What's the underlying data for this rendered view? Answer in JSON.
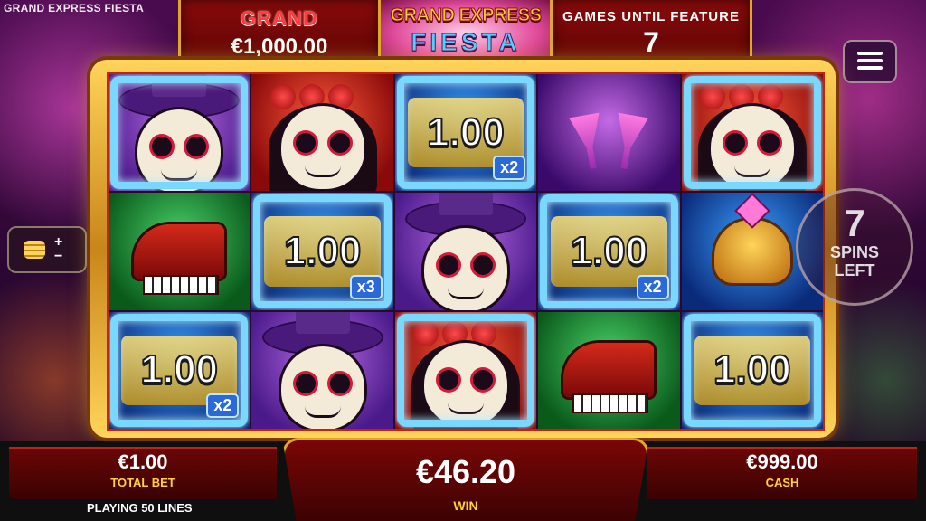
{
  "game": {
    "title": "GRAND EXPRESS FIESTA"
  },
  "logo": {
    "line1": "GRAND EXPRESS",
    "line2": "FIESTA"
  },
  "jackpot": {
    "label": "GRAND",
    "value": "€1,000.00"
  },
  "feature": {
    "label": "GAMES UNTIL FEATURE",
    "value": "7"
  },
  "spins": {
    "count": "7",
    "label1": "SPINS",
    "label2": "LEFT"
  },
  "reels": [
    [
      {
        "symbol": "man-mariachi-icon",
        "bg": "bg-purple",
        "frozen": true
      },
      {
        "symbol": "woman-catrina-icon",
        "bg": "bg-red",
        "frozen": false
      },
      {
        "symbol": "coin",
        "bg": "bg-blue",
        "frozen": true,
        "value": "1.00",
        "mult": "x2"
      },
      {
        "symbol": "cocktail-icon",
        "bg": "bg-violet",
        "frozen": false
      },
      {
        "symbol": "woman-catrina-icon",
        "bg": "bg-red",
        "frozen": true
      }
    ],
    [
      {
        "symbol": "piano-icon",
        "bg": "bg-green",
        "frozen": false
      },
      {
        "symbol": "coin",
        "bg": "bg-blue",
        "frozen": true,
        "value": "1.00",
        "mult": "x3"
      },
      {
        "symbol": "man-mariachi-icon",
        "bg": "bg-purple",
        "frozen": false
      },
      {
        "symbol": "coin",
        "bg": "bg-blue",
        "frozen": true,
        "value": "1.00",
        "mult": "x2"
      },
      {
        "symbol": "skull-icon",
        "bg": "bg-blue",
        "frozen": false
      }
    ],
    [
      {
        "symbol": "coin",
        "bg": "bg-blue",
        "frozen": true,
        "value": "1.00",
        "mult": "x2"
      },
      {
        "symbol": "man-mariachi-icon",
        "bg": "bg-purple",
        "frozen": false
      },
      {
        "symbol": "woman-catrina-icon",
        "bg": "bg-red",
        "frozen": true
      },
      {
        "symbol": "piano-icon",
        "bg": "bg-green",
        "frozen": false
      },
      {
        "symbol": "coin",
        "bg": "bg-blue",
        "frozen": true,
        "value": "1.00",
        "mult": ""
      }
    ]
  ],
  "bottom": {
    "total_bet_value": "€1.00",
    "total_bet_label": "TOTAL BET",
    "win_value": "€46.20",
    "win_label": "WIN",
    "cash_value": "€999.00",
    "cash_label": "CASH",
    "lines_text": "PLAYING 50 LINES"
  },
  "bet_controls": {
    "plus": "+",
    "minus": "−"
  }
}
